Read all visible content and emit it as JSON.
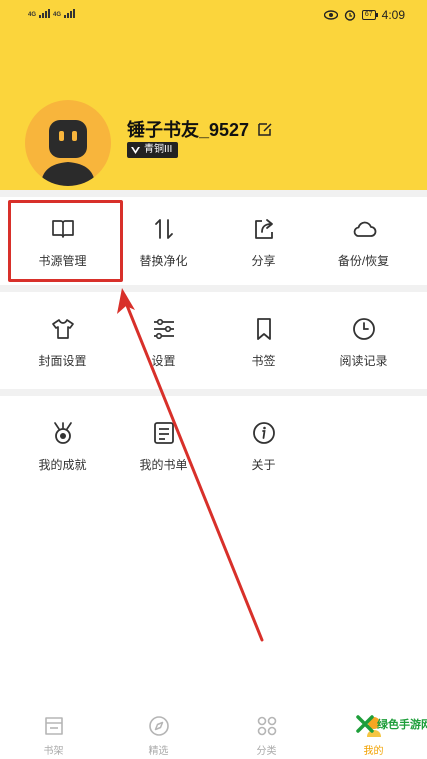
{
  "status_bar": {
    "network_1": "4G",
    "network_2": "4G",
    "time": "4:09",
    "battery": "67"
  },
  "profile": {
    "username": "锤子书友_9527",
    "level_badge": "青铜III"
  },
  "menu": [
    {
      "label": "书源管理",
      "icon": "book-icon"
    },
    {
      "label": "替换净化",
      "icon": "swap-arrows-icon"
    },
    {
      "label": "分享",
      "icon": "share-icon"
    },
    {
      "label": "备份/恢复",
      "icon": "cloud-icon"
    },
    {
      "label": "封面设置",
      "icon": "shirt-icon"
    },
    {
      "label": "设置",
      "icon": "sliders-icon"
    },
    {
      "label": "书签",
      "icon": "bookmark-icon"
    },
    {
      "label": "阅读记录",
      "icon": "clock-icon"
    },
    {
      "label": "我的成就",
      "icon": "medal-icon"
    },
    {
      "label": "我的书单",
      "icon": "list-icon"
    },
    {
      "label": "关于",
      "icon": "info-icon"
    }
  ],
  "tabbar": [
    {
      "label": "书架",
      "icon": "bookshelf-icon",
      "active": false
    },
    {
      "label": "精选",
      "icon": "compass-icon",
      "active": false
    },
    {
      "label": "分类",
      "icon": "grid-icon",
      "active": false
    },
    {
      "label": "我的",
      "icon": "profile-icon",
      "active": true
    }
  ],
  "watermark": {
    "text": "绿色手游网"
  },
  "colors": {
    "header": "#fbd53c",
    "highlight": "#d8302a",
    "active_tab": "#f2a200"
  }
}
